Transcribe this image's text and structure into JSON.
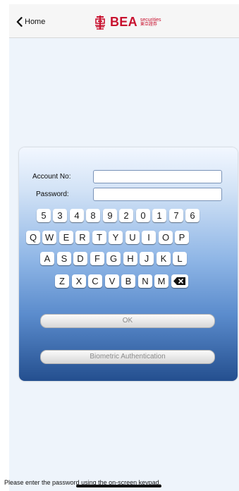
{
  "header": {
    "back_label": "Home",
    "brand_name": "BEA",
    "brand_sub_en": "securities",
    "brand_sub_zh": "東亞證券"
  },
  "form": {
    "account_label": "Account No:",
    "password_label": "Password:",
    "account_value": "",
    "password_value": ""
  },
  "keypad": {
    "digits": [
      "5",
      "3",
      "4",
      "8",
      "9",
      "2",
      "0",
      "1",
      "7",
      "6"
    ],
    "row1": [
      "Q",
      "W",
      "E",
      "R",
      "T",
      "Y",
      "U",
      "I",
      "O",
      "P"
    ],
    "row2": [
      "A",
      "S",
      "D",
      "F",
      "G",
      "H",
      "J",
      "K",
      "L"
    ],
    "row3": [
      "Z",
      "X",
      "C",
      "V",
      "B",
      "N",
      "M"
    ]
  },
  "buttons": {
    "ok": "OK",
    "biometric": "Biometric Authentication"
  },
  "footer": {
    "hint": "Please enter the password using the on-screen keypad."
  },
  "colors": {
    "brand_red": "#c8102e",
    "panel_top": "#f2f7ff",
    "panel_bottom": "#244f8f"
  }
}
